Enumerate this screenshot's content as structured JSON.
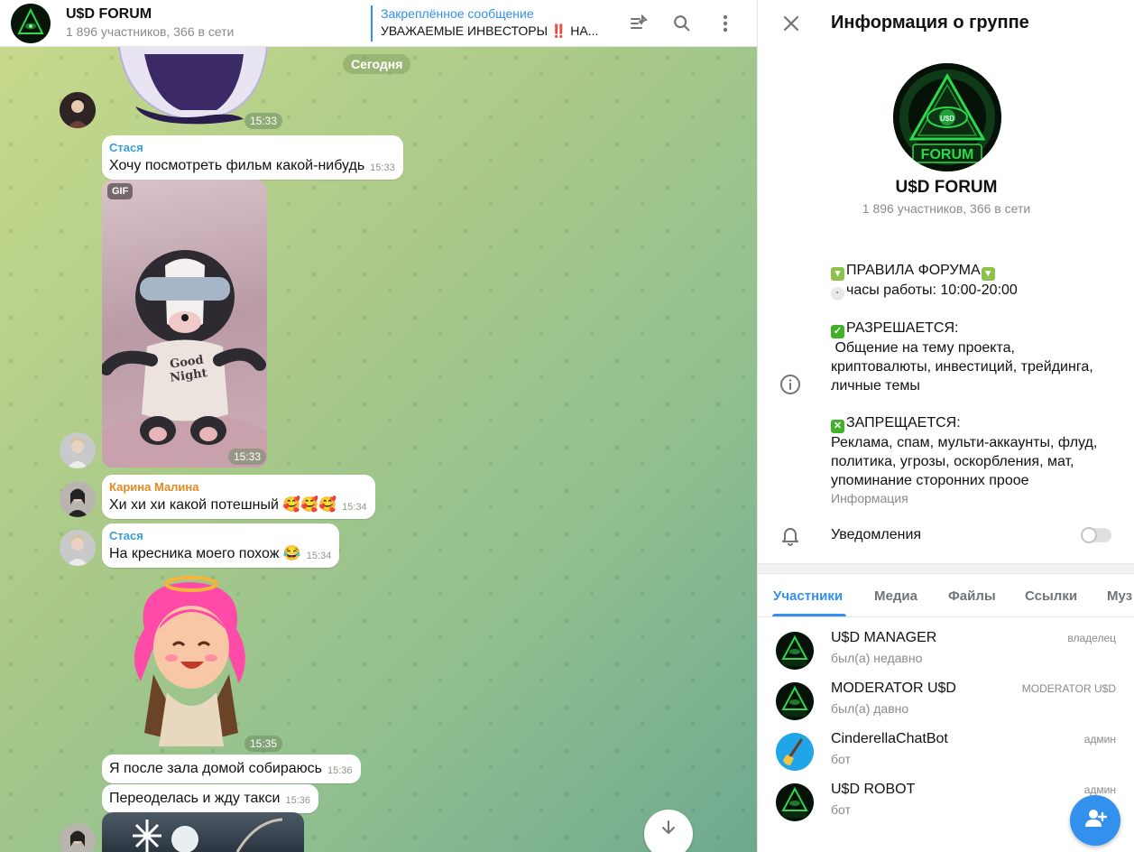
{
  "chat": {
    "title": "U$D FORUM",
    "subtitle": "1 896 участников, 366 в сети",
    "pinned_label": "Закреплённое сообщение",
    "pinned_text": "УВАЖАЕМЫЕ ИНВЕСТОРЫ ‼️ НА...",
    "date_separator": "Сегодня",
    "sticker1_time": "15:33",
    "messages": [
      {
        "sender": "Стася",
        "sender_color": "#3a9fd8",
        "text": "Хочу посмотреть фильм какой-нибудь",
        "time": "15:33"
      },
      {
        "gif_badge": "GIF",
        "time": "15:33",
        "gif_caption": "Good Night"
      },
      {
        "sender": "Карина Малина",
        "sender_color": "#e2891f",
        "text": "Хи хи хи какой потешный 🥰🥰🥰",
        "time": "15:34"
      },
      {
        "sender": "Стася",
        "sender_color": "#3a9fd8",
        "text": "На кресника моего похож 😂",
        "time": "15:34"
      },
      {
        "time": "15:35"
      },
      {
        "text": "Я после зала домой собираюсь",
        "time": "15:36"
      },
      {
        "text": "Переоделась и жду такси",
        "time": "15:36"
      }
    ]
  },
  "panel": {
    "title": "Информация о группе",
    "group_name": "U$D FORUM",
    "group_sub": "1 896 участников, 366 в сети",
    "logo_text": "FORUM",
    "logo_eye_text": "U$D",
    "description": {
      "l1": "ПРАВИЛА ФОРУМА",
      "l2": "часы работы: 10:00-20:00",
      "l3": "РАЗРЕШАЕТСЯ:",
      "l4": " Общение на тему проекта,",
      "l5": "криптовалюты, инвестиций, трейдинга,",
      "l6": "личные темы",
      "l7": "ЗАПРЕЩАЕТСЯ:",
      "l8": "Реклама, спам, мульти-аккаунты, флуд,",
      "l9": "политика, угрозы, оскорбления, мат,",
      "l10": "упоминание сторонних проое"
    },
    "info_caption": "Информация",
    "notifications_label": "Уведомления",
    "notifications_on": false,
    "tabs": [
      "Участники",
      "Медиа",
      "Файлы",
      "Ссылки",
      "Муз"
    ],
    "members": [
      {
        "name": "U$D MANAGER",
        "status": "был(а) недавно",
        "role": "владелец",
        "avatar_text": "MANAGER"
      },
      {
        "name": "MODERATOR U$D",
        "status": "был(а) давно",
        "role": "MODERATOR U$D",
        "avatar_text": "MODERATOR"
      },
      {
        "name": "CinderellaChatBot",
        "status": "бот",
        "role": "админ",
        "avatar_text": ""
      },
      {
        "name": "U$D ROBOT",
        "status": "бот",
        "role": "админ",
        "avatar_text": "ROBOT"
      }
    ]
  },
  "colors": {
    "accent": "#3390ec",
    "logo_green": "#2bd94b"
  }
}
